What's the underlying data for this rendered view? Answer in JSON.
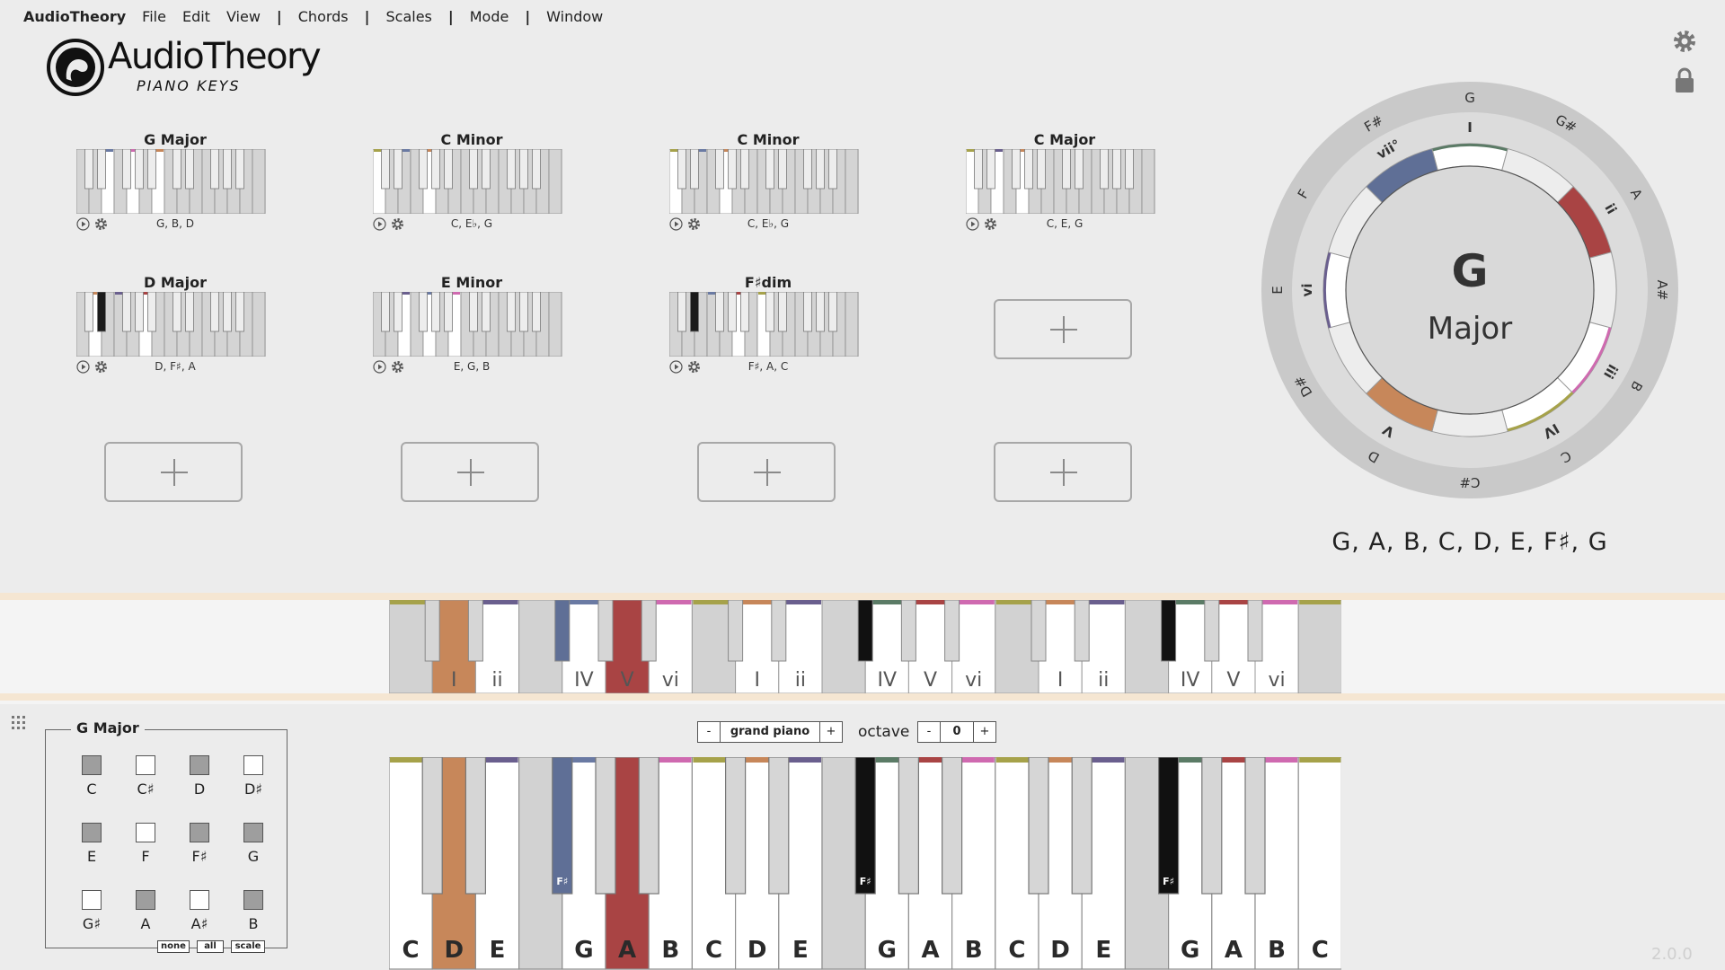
{
  "menu": {
    "app": "AudioTheory",
    "items": [
      "File",
      "Edit",
      "View",
      "|",
      "Chords",
      "|",
      "Scales",
      "|",
      "Mode",
      "|",
      "Window"
    ]
  },
  "logo": {
    "title": "AudioTheory",
    "subtitle": "PIANO KEYS"
  },
  "chords": [
    {
      "name": "G Major",
      "notes": "G, B, D"
    },
    {
      "name": "C Minor",
      "notes": "C, E♭, G"
    },
    {
      "name": "C Minor",
      "notes": "C, E♭, G"
    },
    {
      "name": "C Major",
      "notes": "C, E, G"
    },
    {
      "name": "D Major",
      "notes": "D, F♯, A"
    },
    {
      "name": "E Minor",
      "notes": "E, G, B"
    },
    {
      "name": "F♯dim",
      "notes": "F♯, A, C"
    }
  ],
  "circle": {
    "key": "G",
    "mode": "Major",
    "outer_notes": [
      "G",
      "G#",
      "A",
      "A#",
      "B",
      "C",
      "C#",
      "D",
      "D#",
      "E",
      "F",
      "F#"
    ],
    "degrees": [
      "I",
      "ii",
      "iii",
      "IV",
      "V",
      "vi",
      "vii°"
    ]
  },
  "scale_notes": "G, A, B, C, D, E, F♯, G",
  "degree_strip_labels": [
    "I",
    "ii",
    "IV",
    "V",
    "vi",
    "I",
    "ii",
    "IV",
    "V",
    "vi",
    "I",
    "ii",
    "IV",
    "V",
    "vi"
  ],
  "scale_panel": {
    "title": "G Major",
    "notes": [
      {
        "label": "C",
        "on": true
      },
      {
        "label": "C♯",
        "on": false
      },
      {
        "label": "D",
        "on": true
      },
      {
        "label": "D♯",
        "on": false
      },
      {
        "label": "E",
        "on": true
      },
      {
        "label": "F",
        "on": false
      },
      {
        "label": "F♯",
        "on": true
      },
      {
        "label": "G",
        "on": true
      },
      {
        "label": "G♯",
        "on": false
      },
      {
        "label": "A",
        "on": true
      },
      {
        "label": "A♯",
        "on": false
      },
      {
        "label": "B",
        "on": true
      }
    ],
    "buttons": {
      "none": "none",
      "all": "all",
      "scale": "scale"
    }
  },
  "instrument": {
    "minus": "-",
    "value": "grand piano",
    "plus": "+"
  },
  "octave": {
    "label": "octave",
    "minus": "-",
    "value": "0",
    "plus": "+"
  },
  "keyboard_white_labels": [
    "C",
    "D",
    "E",
    "",
    "G",
    "A",
    "B",
    "C",
    "D",
    "E",
    "",
    "G",
    "A",
    "B",
    "C",
    "D",
    "E",
    "",
    "G",
    "A",
    "B",
    "C"
  ],
  "keyboard_black_label": "F♯",
  "colors": {
    "I": "#c7875a",
    "ii": "#a94444",
    "iii": "#cf6ab0",
    "IV": "#6a7aa3",
    "V": "#c7875a",
    "vi": "#6a5f8e",
    "vii": "#5f6f96",
    "green": "#5b7b66",
    "olive": "#a6a24a"
  },
  "version": "2.0.0"
}
